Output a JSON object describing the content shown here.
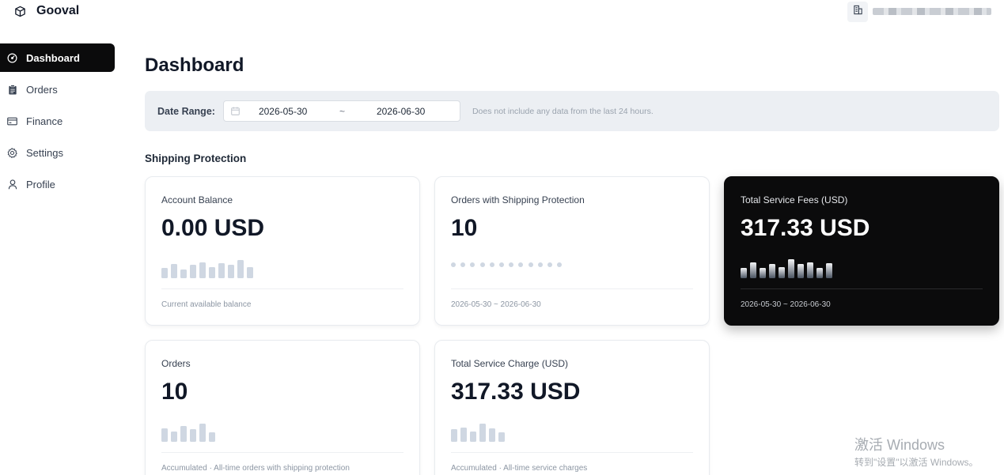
{
  "app": {
    "name": "Gooval",
    "store_icon": "store-building-icon"
  },
  "sidebar": {
    "items": [
      {
        "label": "Dashboard",
        "icon": "dashboard-gauge-icon",
        "active": true
      },
      {
        "label": "Orders",
        "icon": "clipboard-icon",
        "active": false
      },
      {
        "label": "Finance",
        "icon": "credit-card-icon",
        "active": false
      },
      {
        "label": "Settings",
        "icon": "gear-icon",
        "active": false
      },
      {
        "label": "Profile",
        "icon": "user-icon",
        "active": false
      }
    ]
  },
  "main": {
    "title": "Dashboard",
    "date_range": {
      "label": "Date Range:",
      "start": "2026-05-30",
      "separator": "~",
      "end": "2026-06-30",
      "note": "Does not include any data from the last 24 hours.",
      "icon": "calendar-icon"
    },
    "section_title": "Shipping Protection",
    "cards": [
      {
        "label": "Account Balance",
        "value": "0.00 USD",
        "footer": "Current available balance",
        "dark": false,
        "bars": [
          0.55,
          0.75,
          0.45,
          0.7,
          0.85,
          0.6,
          0.8,
          0.7,
          0.95,
          0.6
        ]
      },
      {
        "label": "Orders with Shipping Protection",
        "value": "10",
        "footer": "2026-05-30 ~ 2026-06-30",
        "dark": false,
        "dots": 12
      },
      {
        "label": "Total Service Fees (USD)",
        "value": "317.33 USD",
        "footer": "2026-05-30 ~ 2026-06-30",
        "dark": true,
        "bars": [
          0.55,
          0.85,
          0.55,
          0.75,
          0.6,
          1.0,
          0.75,
          0.85,
          0.55,
          0.8
        ]
      },
      {
        "label": "Orders",
        "value": "10",
        "footer": "Accumulated · All-time orders with shipping protection",
        "dark": false,
        "bars": [
          0.7,
          0.55,
          0.85,
          0.65,
          0.95,
          0.5
        ]
      },
      {
        "label": "Total Service Charge (USD)",
        "value": "317.33 USD",
        "footer": "Accumulated · All-time service charges",
        "dark": false,
        "bars": [
          0.65,
          0.75,
          0.55,
          0.95,
          0.7,
          0.5
        ]
      }
    ]
  },
  "watermark": {
    "title": "激活 Windows",
    "subtitle": "转到\"设置\"以激活 Windows。"
  }
}
